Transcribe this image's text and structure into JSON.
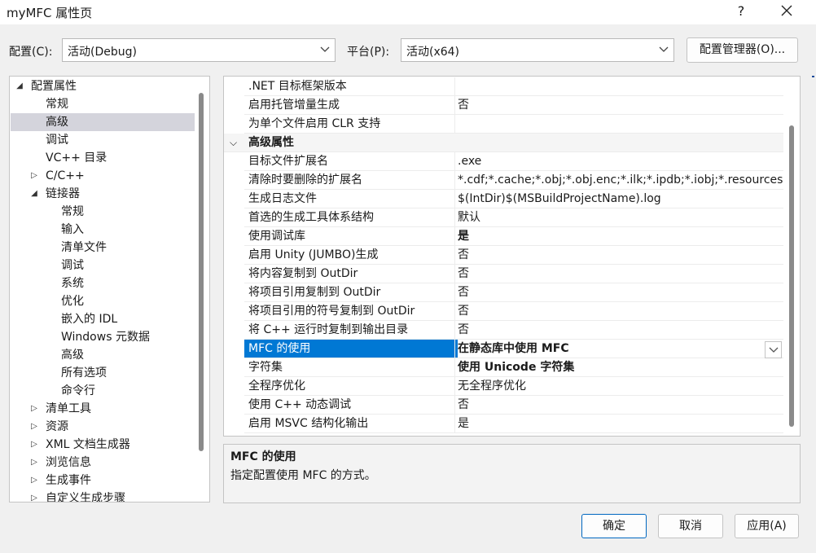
{
  "window": {
    "title": "myMFC 属性页",
    "help_glyph": "?",
    "close_label": "close"
  },
  "config": {
    "label": "配置(C):",
    "value": "活动(Debug)"
  },
  "platform": {
    "label": "平台(P):",
    "value": "活动(x64)"
  },
  "config_manager_label": "配置管理器(O)...",
  "tree": {
    "items": [
      {
        "label": "配置属性",
        "level": 0,
        "expander": "expanded"
      },
      {
        "label": "常规",
        "level": 1,
        "expander": "none"
      },
      {
        "label": "高级",
        "level": 1,
        "expander": "none",
        "selected": true
      },
      {
        "label": "调试",
        "level": 1,
        "expander": "none"
      },
      {
        "label": "VC++ 目录",
        "level": 1,
        "expander": "none"
      },
      {
        "label": "C/C++",
        "level": 1,
        "expander": "collapsed"
      },
      {
        "label": "链接器",
        "level": 1,
        "expander": "expanded"
      },
      {
        "label": "常规",
        "level": 2,
        "expander": "none"
      },
      {
        "label": "输入",
        "level": 2,
        "expander": "none"
      },
      {
        "label": "清单文件",
        "level": 2,
        "expander": "none"
      },
      {
        "label": "调试",
        "level": 2,
        "expander": "none"
      },
      {
        "label": "系统",
        "level": 2,
        "expander": "none"
      },
      {
        "label": "优化",
        "level": 2,
        "expander": "none"
      },
      {
        "label": "嵌入的 IDL",
        "level": 2,
        "expander": "none"
      },
      {
        "label": "Windows 元数据",
        "level": 2,
        "expander": "none"
      },
      {
        "label": "高级",
        "level": 2,
        "expander": "none"
      },
      {
        "label": "所有选项",
        "level": 2,
        "expander": "none"
      },
      {
        "label": "命令行",
        "level": 2,
        "expander": "none"
      },
      {
        "label": "清单工具",
        "level": 1,
        "expander": "collapsed"
      },
      {
        "label": "资源",
        "level": 1,
        "expander": "collapsed"
      },
      {
        "label": "XML 文档生成器",
        "level": 1,
        "expander": "collapsed"
      },
      {
        "label": "浏览信息",
        "level": 1,
        "expander": "collapsed"
      },
      {
        "label": "生成事件",
        "level": 1,
        "expander": "collapsed"
      },
      {
        "label": "自定义生成步骤",
        "level": 1,
        "expander": "collapsed"
      }
    ]
  },
  "grid": {
    "rows": [
      {
        "name": ".NET 目标框架版本",
        "value": ""
      },
      {
        "name": "启用托管增量生成",
        "value": "否"
      },
      {
        "name": "为单个文件启用 CLR 支持",
        "value": ""
      },
      {
        "name": "高级属性",
        "category": true
      },
      {
        "name": "目标文件扩展名",
        "value": ".exe"
      },
      {
        "name": "清除时要删除的扩展名",
        "value": "*.cdf;*.cache;*.obj;*.obj.enc;*.ilk;*.ipdb;*.iobj;*.resources"
      },
      {
        "name": "生成日志文件",
        "value": "$(IntDir)$(MSBuildProjectName).log"
      },
      {
        "name": "首选的生成工具体系结构",
        "value": "默认"
      },
      {
        "name": "使用调试库",
        "value": "是",
        "bold": true
      },
      {
        "name": "启用 Unity (JUMBO)生成",
        "value": "否"
      },
      {
        "name": "将内容复制到 OutDir",
        "value": "否"
      },
      {
        "name": "将项目引用复制到 OutDir",
        "value": "否"
      },
      {
        "name": "将项目引用的符号复制到 OutDir",
        "value": "否"
      },
      {
        "name": "将 C++ 运行时复制到输出目录",
        "value": "否"
      },
      {
        "name": "MFC 的使用",
        "value": "在静态库中使用 MFC",
        "selected": true
      },
      {
        "name": "字符集",
        "value": "使用 Unicode 字符集",
        "bold": true
      },
      {
        "name": "全程序优化",
        "value": "无全程序优化"
      },
      {
        "name": "使用 C++ 动态调试",
        "value": "否"
      },
      {
        "name": "启用 MSVC 结构化输出",
        "value": "是"
      }
    ]
  },
  "description": {
    "title": "MFC 的使用",
    "text": "指定配置使用 MFC 的方式。"
  },
  "buttons": {
    "ok": "确定",
    "cancel": "取消",
    "apply": "应用(A)"
  },
  "colors": {
    "selection": "#0078d4",
    "tree_selection": "#d4d4dc"
  }
}
